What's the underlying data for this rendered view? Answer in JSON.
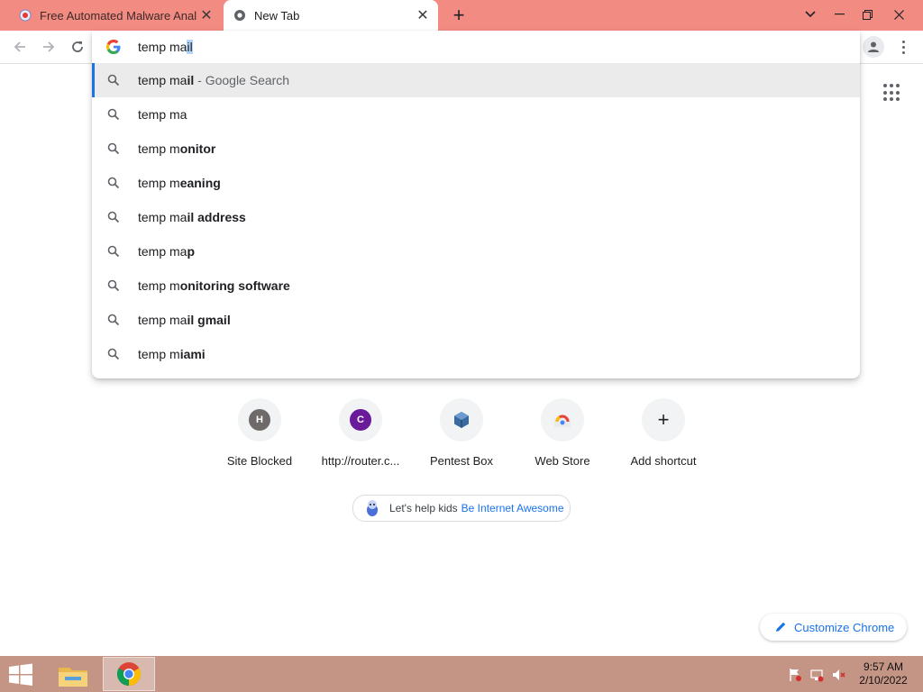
{
  "tabs": [
    {
      "title": "Free Automated Malware Analysis",
      "close": "✕"
    },
    {
      "title": "New Tab",
      "close": "✕"
    }
  ],
  "newtab_symbol": "+",
  "window_controls": {
    "dropdown": "⌄",
    "minimize": "—",
    "restore": "❐",
    "close": "✕"
  },
  "omnibox": {
    "typed": "temp ma",
    "autocomplete": "il",
    "suggestions": [
      {
        "plain": "temp ma",
        "bold": "il",
        "suffix": " - Google Search",
        "active": true
      },
      {
        "plain": "temp ma",
        "bold": "",
        "suffix": ""
      },
      {
        "plain": "temp m",
        "bold": "onitor",
        "suffix": ""
      },
      {
        "plain": "temp m",
        "bold": "eaning",
        "suffix": ""
      },
      {
        "plain": "temp ma",
        "bold": "il address",
        "suffix": ""
      },
      {
        "plain": "temp ma",
        "bold": "p",
        "suffix": ""
      },
      {
        "plain": "temp m",
        "bold": "onitoring software",
        "suffix": ""
      },
      {
        "plain": "temp ma",
        "bold": "il gmail",
        "suffix": ""
      },
      {
        "plain": "temp m",
        "bold": "iami",
        "suffix": ""
      }
    ]
  },
  "shortcuts": [
    {
      "letter": "H",
      "label": "Site Blocked",
      "color": "#6e6a6a"
    },
    {
      "letter": "C",
      "label": "http://router.c...",
      "color": "#6a1b9a"
    },
    {
      "letter": "",
      "label": "Pentest Box",
      "color": "#3b6aa0"
    },
    {
      "letter": "",
      "label": "Web Store",
      "color": "#1a73e8"
    },
    {
      "letter": "+",
      "label": "Add shortcut",
      "color": "#202124"
    }
  ],
  "promo": {
    "text": "Let's help kids",
    "link": "Be Internet Awesome"
  },
  "customize_label": "Customize Chrome",
  "clock": {
    "time": "9:57 AM",
    "date": "2/10/2022"
  },
  "colors": {
    "tabstrip": "#f28b82",
    "taskbar": "#c49484",
    "accent": "#1a73e8"
  }
}
